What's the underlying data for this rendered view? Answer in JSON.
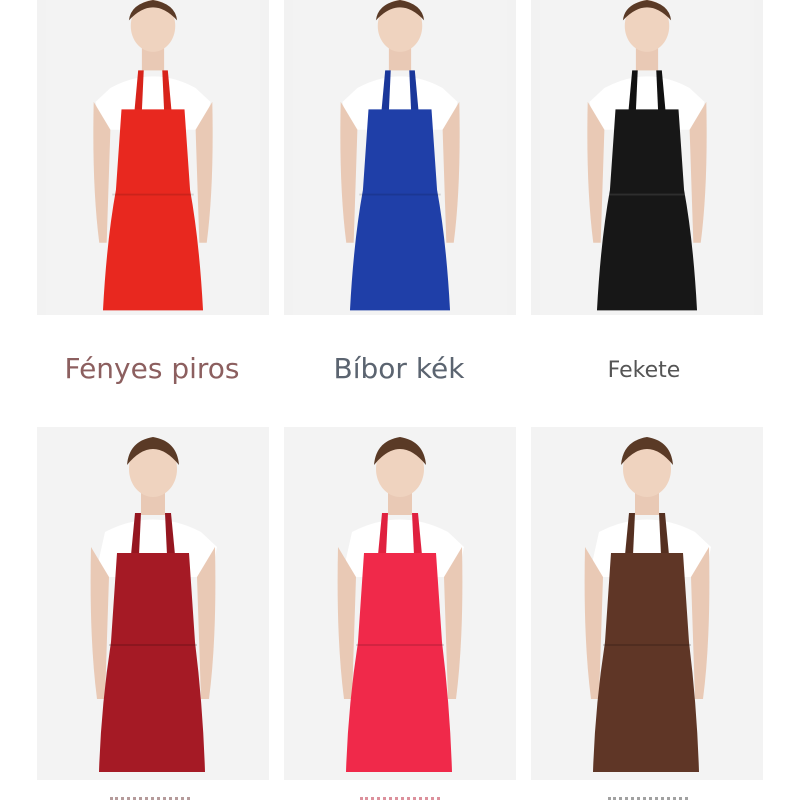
{
  "products": [
    {
      "caption": "Fényes piros",
      "apron_color": "#e8281f",
      "strap_color": "#d8231b"
    },
    {
      "caption": "Bíbor kék",
      "apron_color": "#1f3fa8",
      "strap_color": "#1a379a"
    },
    {
      "caption": "Fekete",
      "apron_color": "#171717",
      "strap_color": "#111111"
    },
    {
      "caption": "",
      "apron_color": "#a51a25",
      "strap_color": "#951620"
    },
    {
      "caption": "",
      "apron_color": "#f0294a",
      "strap_color": "#e0213f"
    },
    {
      "caption": "",
      "apron_color": "#5f3626",
      "strap_color": "#553021"
    }
  ]
}
